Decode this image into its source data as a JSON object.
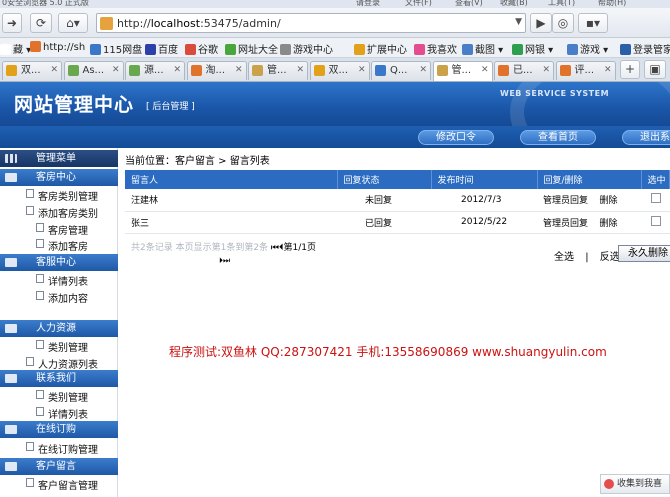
{
  "browser": {
    "title_fragments": [
      "0安全浏览器 5.0 正式版",
      "请登录",
      "文件(F)",
      "查看(V)",
      "收藏(B)",
      "工具(T)",
      "帮助(H)"
    ],
    "url_prefix": "http://",
    "url_host": "localhost",
    "url_rest": ":53475/admin/",
    "bookmarks": [
      {
        "label": "藏 ▾",
        "color": "#ffffff"
      },
      {
        "label": "http://sh",
        "color": "#e0722b"
      },
      {
        "label": "115网盘",
        "color": "#3a77c9"
      },
      {
        "label": "百度",
        "color": "#2d3fa8"
      },
      {
        "label": "谷歌",
        "color": "#d94b3b"
      },
      {
        "label": "网址大全",
        "color": "#4aa53b"
      },
      {
        "label": "游戏中心",
        "color": "#8a8a8a"
      },
      {
        "label": "扩展中心",
        "color": "#e3a019"
      },
      {
        "label": "我喜欢",
        "color": "#e34d8f"
      },
      {
        "label": "截图 ▾",
        "color": "#4a7fc8"
      },
      {
        "label": "网银 ▾",
        "color": "#2e9e4f"
      },
      {
        "label": "游戏 ▾",
        "color": "#4a7fc8"
      },
      {
        "label": "登录管家",
        "color": "#2b5fa8"
      }
    ],
    "tabs": [
      {
        "label": "双...",
        "color": "#e3a019"
      },
      {
        "label": "As...",
        "color": "#6aa84f"
      },
      {
        "label": "源...",
        "color": "#6aa84f"
      },
      {
        "label": "淘...",
        "color": "#e0722b"
      },
      {
        "label": "管...",
        "color": "#c9a24b"
      },
      {
        "label": "双...",
        "color": "#e3a019"
      },
      {
        "label": "Q...",
        "color": "#3a77c9"
      },
      {
        "label": "管...",
        "color": "#c9a24b"
      },
      {
        "label": "已...",
        "color": "#e0722b"
      },
      {
        "label": "评...",
        "color": "#e0722b"
      }
    ],
    "new_tab": "+"
  },
  "app": {
    "title": "网站管理中心",
    "subtitle": "[ 后台管理 ]",
    "tagline": "WEB SERVICE SYSTEM",
    "header_buttons": [
      "修改口令",
      "查看首页",
      "退出系统"
    ]
  },
  "sidebar": {
    "menu_title": "管理菜单",
    "groups": [
      {
        "title": "客房中心",
        "items": [
          "客房类别管理",
          "添加客房类别",
          "客房管理",
          "添加客房"
        ]
      },
      {
        "title": "客服中心",
        "items": [
          "详情列表",
          "添加内容"
        ]
      },
      {
        "title": "人力资源",
        "items": [
          "类别管理",
          "人力资源列表"
        ]
      },
      {
        "title": "联系我们",
        "items": [
          "类别管理",
          "详情列表"
        ]
      },
      {
        "title": "在线订购",
        "items": [
          "在线订购管理"
        ]
      },
      {
        "title": "客户留言",
        "items": [
          "客户留言管理"
        ]
      }
    ]
  },
  "main": {
    "breadcrumb": "当前位置：客户留言 >   留言列表",
    "columns": [
      "留言人",
      "回复状态",
      "发布时间",
      "回复/删除",
      "选中"
    ],
    "rows": [
      {
        "name": "汪建林",
        "status": "未回复",
        "date": "2012/7/3",
        "reply": "管理员回复",
        "delete": "删除"
      },
      {
        "name": "张三",
        "status": "已回复",
        "date": "2012/5/22",
        "reply": "管理员回复",
        "delete": "删除"
      }
    ],
    "pager_text": "共2条记录  本页显示第1条到第2条",
    "pager_page": "⏮⏴第1/1页",
    "pager_next": "⏵⏭",
    "select_all": "全选",
    "separator": "|",
    "invert": "反选",
    "delete_button": "永久删除",
    "contact": "程序测试:双鱼林 QQ:287307421 手机:13558690869 www.shuangyulin.com"
  },
  "corner": {
    "label": "收集到我喜"
  }
}
